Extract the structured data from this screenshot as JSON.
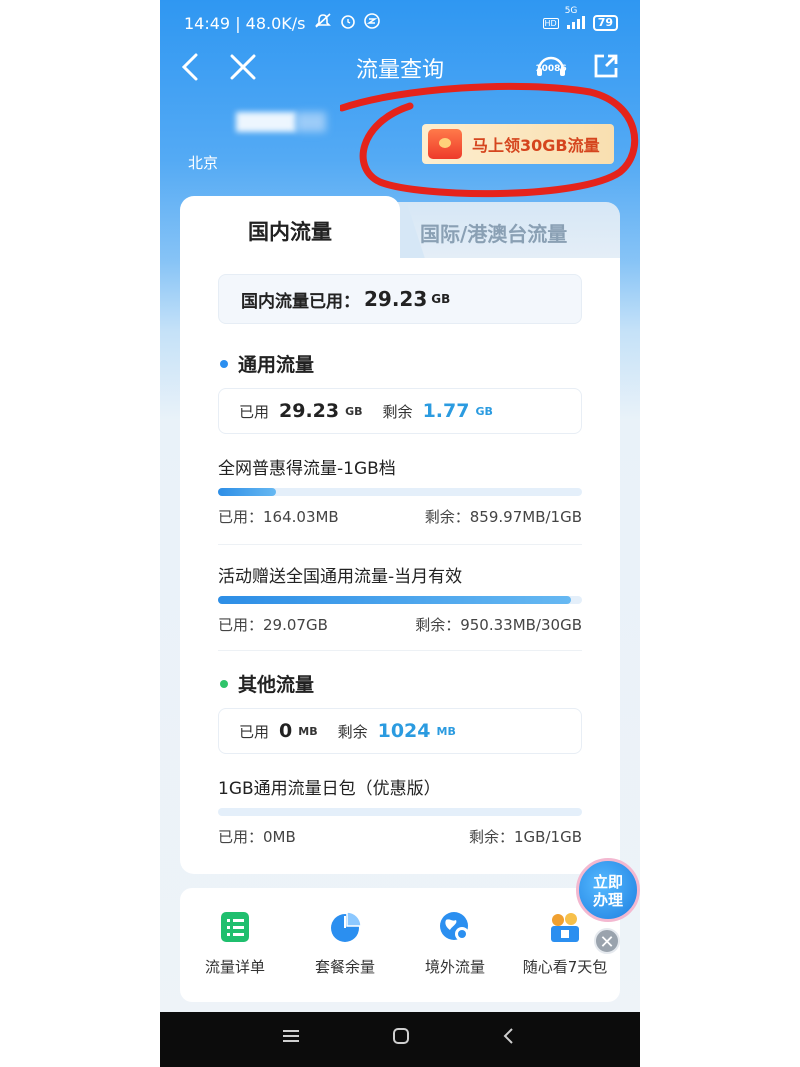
{
  "status_bar": {
    "time_speed": "14:49 | 48.0K/s",
    "network": "5G",
    "battery": "79"
  },
  "nav": {
    "title": "流量查询",
    "service_icon_label": "10086"
  },
  "account": {
    "city": "北京"
  },
  "promo": {
    "label": "马上领30GB流量"
  },
  "tabs": {
    "domestic": "国内流量",
    "international": "国际/港澳台流量"
  },
  "total": {
    "label": "国内流量已用：",
    "value": "29.23",
    "unit": "GB"
  },
  "general": {
    "title": "通用流量",
    "used_label": "已用",
    "used_value": "29.23",
    "used_unit": "GB",
    "remain_label": "剩余",
    "remain_value": "1.77",
    "remain_unit": "GB",
    "items": [
      {
        "name": "全网普惠得流量-1GB档",
        "used": "已用：164.03MB",
        "remain": "剩余：859.97MB/1GB",
        "fraction": 0.16
      },
      {
        "name": "活动赠送全国通用流量-当月有效",
        "used": "已用：29.07GB",
        "remain": "剩余：950.33MB/30GB",
        "fraction": 0.969
      }
    ]
  },
  "other": {
    "title": "其他流量",
    "used_label": "已用",
    "used_value": "0",
    "used_unit": "MB",
    "remain_label": "剩余",
    "remain_value": "1024",
    "remain_unit": "MB",
    "items": [
      {
        "name": "1GB通用流量日包（优惠版）",
        "used": "已用：0MB",
        "remain": "剩余：1GB/1GB",
        "fraction": 0
      }
    ]
  },
  "shortcuts": [
    {
      "label": "流量详单",
      "icon": "list-icon",
      "color": "#1fbf6e"
    },
    {
      "label": "套餐余量",
      "icon": "pie-chart-icon",
      "color": "#2b8ff0"
    },
    {
      "label": "境外流量",
      "icon": "globe-icon",
      "color": "#2b8ff0"
    },
    {
      "label": "随心看7天包",
      "icon": "video-package-icon",
      "color": "#f0a030"
    }
  ],
  "floating": {
    "label": "立即办理"
  },
  "colors": {
    "accent": "#2b9be0",
    "header_blue": "#2f97f2",
    "general_dot": "#2b8ff0",
    "other_dot": "#2fc46a",
    "marker_red": "#e5231b"
  }
}
